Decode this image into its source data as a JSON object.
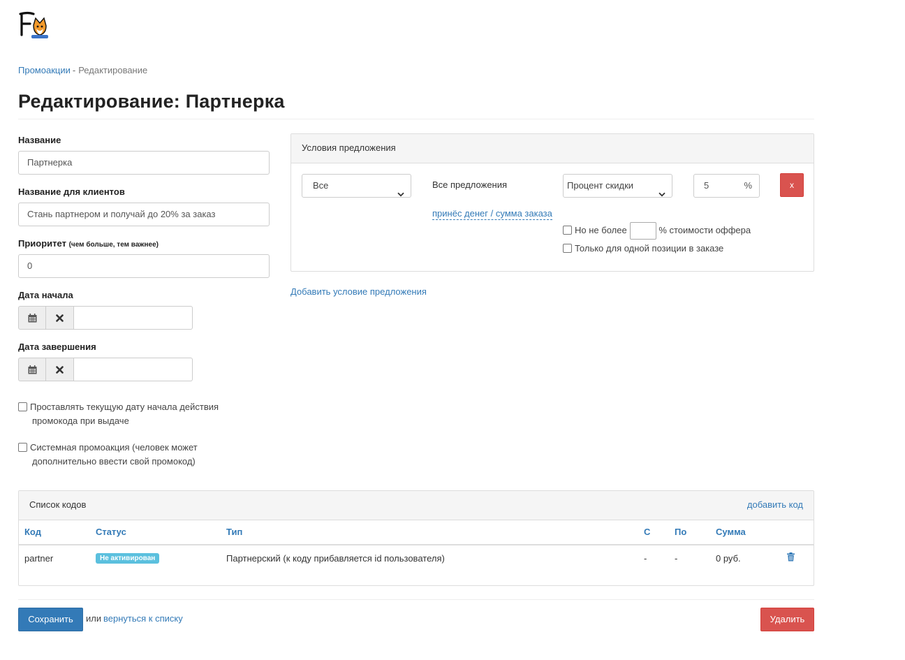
{
  "header": {
    "logo_icon": "fox-logo-icon"
  },
  "breadcrumb": {
    "link": "Промоакции",
    "separator": "-",
    "current": "Редактирование"
  },
  "page_title": "Редактирование: Партнерка",
  "form": {
    "name_label": "Название",
    "name_value": "Партнерка",
    "client_name_label": "Название для клиентов",
    "client_name_value": "Стань партнером и получай до 20% за заказ",
    "priority_label": "Приоритет",
    "priority_hint": "(чем больше, тем важнее)",
    "priority_value": "0",
    "start_date_label": "Дата начала",
    "end_date_label": "Дата завершения",
    "auto_date_label_line1": "Проставлять текущую дату начала действия",
    "auto_date_label_line2": "промокода при выдаче",
    "system_promo_label_line1": "Системная промоакция (человек может",
    "system_promo_label_line2": "дополнительно ввести свой промокод)"
  },
  "conditions": {
    "title": "Условия предложения",
    "scope_select": "Все",
    "offers_text": "Все предложения",
    "type_select": "Процент скидки",
    "amount_value": "5",
    "amount_unit": "%",
    "remove_label": "x",
    "source_link": "принёс денег / сумма заказа",
    "limit_label_before": "Но не более",
    "limit_label_after": "% стоимости оффера",
    "single_position_label": "Только для одной позиции в заказе",
    "add_condition_link": "Добавить условие предложения"
  },
  "codes": {
    "title": "Список кодов",
    "add_code_link": "добавить код",
    "columns": [
      "Код",
      "Статус",
      "Тип",
      "С",
      "По",
      "Сумма"
    ],
    "rows": [
      {
        "code": "partner",
        "status": "Не активирован",
        "type": "Партнерский (к коду прибавляется id пользователя)",
        "from": "-",
        "to": "-",
        "sum": "0 руб."
      }
    ]
  },
  "footer": {
    "save_label": "Сохранить",
    "or_text": "или",
    "back_link": "вернуться к списку",
    "delete_label": "Удалить"
  },
  "colors": {
    "primary": "#337ab7",
    "danger": "#d9534f",
    "info_badge": "#5bc0de"
  }
}
